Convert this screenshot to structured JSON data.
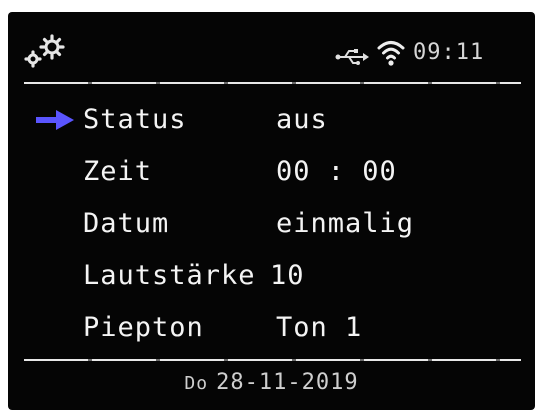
{
  "status_bar": {
    "settings_icon": "gears-icon",
    "usb_icon": "usb-icon",
    "wifi_icon": "wifi-icon",
    "time": "09:11"
  },
  "menu": {
    "selected_index": 0,
    "selector_color": "#5a55ff",
    "items": [
      {
        "label": "Status",
        "value": "aus"
      },
      {
        "label": "Zeit",
        "value": "00 : 00"
      },
      {
        "label": "Datum",
        "value": "einmalig"
      },
      {
        "label": "Lautstärke",
        "value": "10"
      },
      {
        "label": "Piepton",
        "value": "Ton 1"
      }
    ]
  },
  "footer": {
    "weekday": "Do",
    "date": "28-11-2019"
  }
}
